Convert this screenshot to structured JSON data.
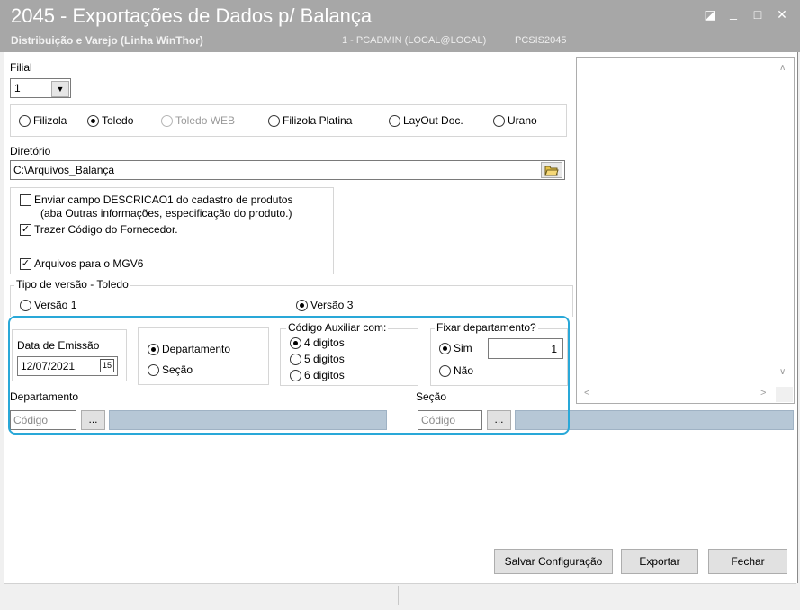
{
  "window": {
    "title": "2045 - Exportações de Dados p/ Balança",
    "subtitle": "Distribuição e Varejo (Linha WinThor)",
    "user_info": "1 - PCADMIN (LOCAL@LOCAL)",
    "module_code": "PCSIS2045",
    "controls": {
      "restore": "◪",
      "minimize": "_",
      "maximize": "□",
      "close": "✕"
    }
  },
  "filial": {
    "label": "Filial",
    "value": "1"
  },
  "balanca_options": [
    {
      "label": "Filizola",
      "selected": false,
      "enabled": true
    },
    {
      "label": "Toledo",
      "selected": true,
      "enabled": true
    },
    {
      "label": "Toledo WEB",
      "selected": false,
      "enabled": false
    },
    {
      "label": "Filizola Platina",
      "selected": false,
      "enabled": true
    },
    {
      "label": "LayOut Doc.",
      "selected": false,
      "enabled": true
    },
    {
      "label": "Urano",
      "selected": false,
      "enabled": true
    }
  ],
  "diretorio": {
    "label": "Diretório",
    "value": "C:\\Arquivos_Balança"
  },
  "checkboxes": {
    "descricao_line1": "Enviar campo DESCRICAO1 do cadastro de produtos",
    "descricao_line2": "(aba Outras informações, especificação do produto.)",
    "fornecedor": "Trazer Código do Fornecedor.",
    "mgv6": "Arquivos para o MGV6"
  },
  "versao": {
    "legend": "Tipo de versão - Toledo",
    "v1": "Versão 1",
    "v3": "Versão 3"
  },
  "data_emissao": {
    "label": "Data de Emissão",
    "value": "12/07/2021",
    "calendar_icon": "15"
  },
  "tipo": {
    "departamento": "Departamento",
    "secao": "Seção"
  },
  "codigo_auxiliar": {
    "legend": "Código Auxiliar com:",
    "d4": "4 digitos",
    "d5": "5 digitos",
    "d6": "6 digitos"
  },
  "fixar": {
    "legend": "Fixar departamento?",
    "sim": "Sim",
    "nao": "Não",
    "value": "1"
  },
  "departamento": {
    "label": "Departamento",
    "placeholder": "Código",
    "browse": "..."
  },
  "secao": {
    "label": "Seção",
    "placeholder": "Código",
    "browse": "..."
  },
  "buttons": {
    "salvar": "Salvar Configuração",
    "exportar": "Exportar",
    "fechar": "Fechar"
  },
  "colors": {
    "titlebar": "#a7a7a7",
    "highlight": "#29a8d8",
    "readonly": "#b6c7d6"
  }
}
